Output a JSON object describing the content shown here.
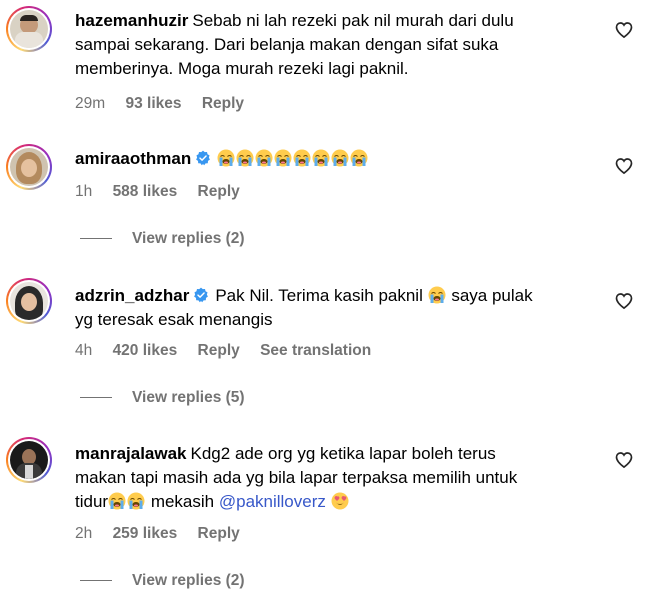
{
  "comments": [
    {
      "username": "hazemanhuzir",
      "verified": false,
      "text_lines": [
        "Sebab ni lah rezeki pak nil murah dari dulu",
        "sampai sekarang. Dari belanja makan dengan sifat suka",
        "memberinya. Moga murah rezeki lagi paknil."
      ],
      "time": "29m",
      "likes": "93 likes",
      "reply": "Reply"
    },
    {
      "username": "amiraaothman",
      "verified": true,
      "emoji_count": 8,
      "time": "1h",
      "likes": "588 likes",
      "reply": "Reply",
      "view_replies": "View replies (2)"
    },
    {
      "username": "adzrin_adzhar",
      "verified": true,
      "text_line1_a": "Pak Nil. Terima kasih paknil",
      "text_line1_b": "saya pulak",
      "text_line2": "yg teresak esak menangis",
      "time": "4h",
      "likes": "420 likes",
      "reply": "Reply",
      "translation": "See translation",
      "view_replies": "View replies (5)"
    },
    {
      "username": "manrajalawak",
      "verified": false,
      "text_line1": "Kdg2 ade org yg ketika lapar boleh terus",
      "text_line2": "makan tapi masih ada yg bila lapar terpaksa memilih untuk",
      "text_line3_a": "tidur",
      "text_line3_b": "mekasih",
      "mention": "@paknilloverz",
      "time": "2h",
      "likes": "259 likes",
      "reply": "Reply",
      "view_replies": "View replies (2)"
    }
  ],
  "icons": {
    "heart": "heart-outline-icon",
    "verified": "verified-badge-icon",
    "emoji_cry": "loudly-crying-face-emoji",
    "emoji_love": "heart-eyes-emoji"
  },
  "colors": {
    "meta": "#737373",
    "mention": "#3858c9",
    "verified": "#3897f0"
  }
}
